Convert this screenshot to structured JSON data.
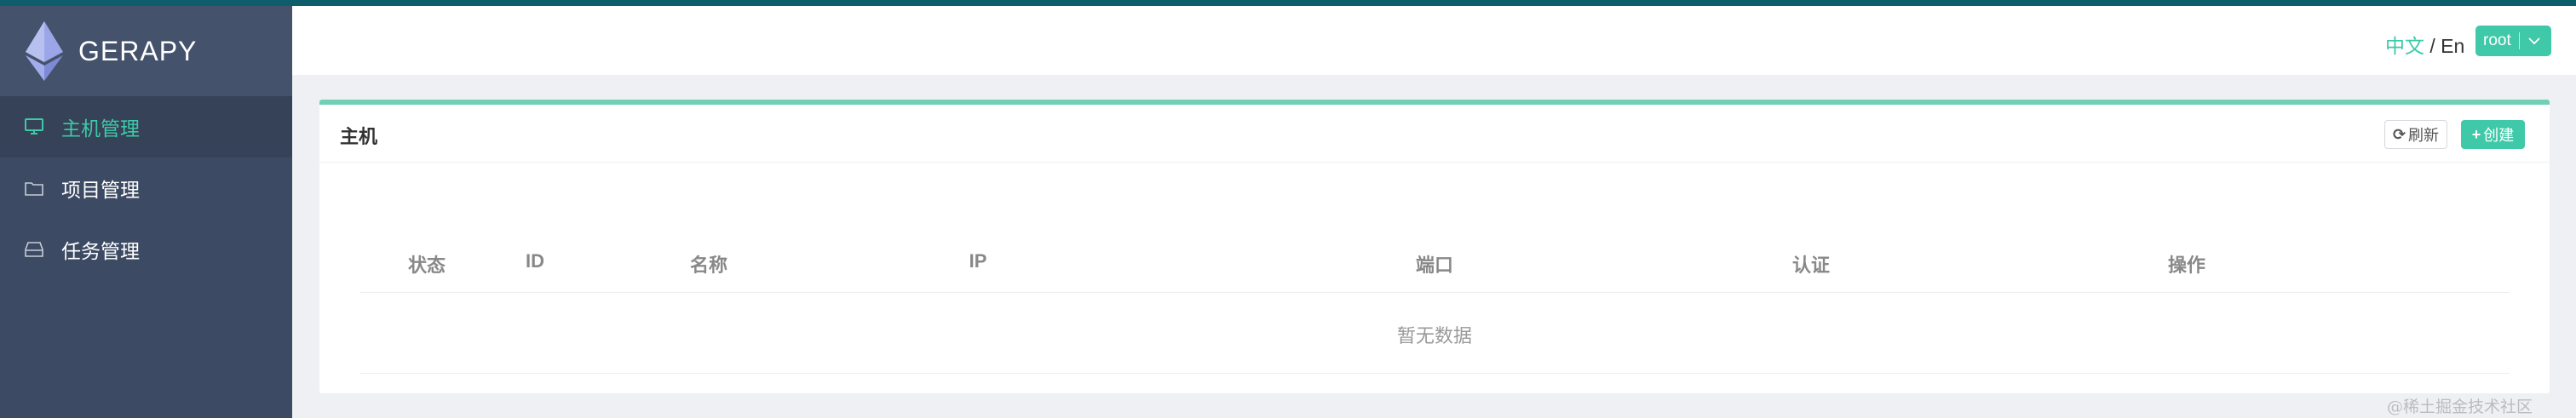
{
  "brand": {
    "name": "GERAPY"
  },
  "sidebar": {
    "items": [
      {
        "label": "主机管理",
        "icon": "monitor-icon",
        "active": true
      },
      {
        "label": "项目管理",
        "icon": "folder-icon",
        "active": false
      },
      {
        "label": "任务管理",
        "icon": "inbox-icon",
        "active": false
      }
    ]
  },
  "header": {
    "lang_zh": "中文",
    "lang_sep": " / ",
    "lang_en": "En",
    "user": "root"
  },
  "main": {
    "title": "主机",
    "refresh_label": "刷新",
    "create_label": "创建",
    "columns": [
      "状态",
      "ID",
      "名称",
      "IP",
      "端口",
      "认证",
      "操作"
    ],
    "empty_text": "暂无数据"
  },
  "watermark": "@稀土掘金技术社区",
  "colors": {
    "accent": "#3fc9a8",
    "sidebar": "#3c4a63",
    "topbar": "#0d5d6b"
  }
}
